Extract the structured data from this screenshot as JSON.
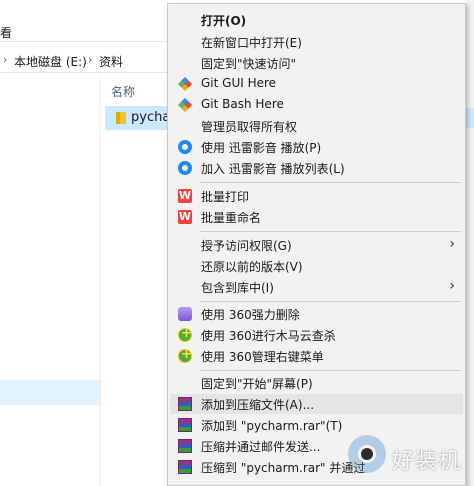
{
  "explorer": {
    "ribbon_view": "看",
    "breadcrumb": [
      "本地磁盘 (E:)",
      "资料"
    ],
    "column_name": "名称",
    "file_name": "pycharm"
  },
  "menu": {
    "open": "打开(O)",
    "open_new_window": "在新窗口中打开(E)",
    "pin_quick_access": "固定到\"快速访问\"",
    "git_gui": "Git GUI Here",
    "git_bash": "Git Bash Here",
    "take_ownership": "管理员取得所有权",
    "xunlei_play": "使用 迅雷影音 播放(P)",
    "xunlei_add": "加入 迅雷影音 播放列表(L)",
    "batch_print": "批量打印",
    "batch_rename": "批量重命名",
    "grant_access": "授予访问权限(G)",
    "restore_versions": "还原以前的版本(V)",
    "include_library": "包含到库中(I)",
    "s360_delete": "使用 360强力删除",
    "s360_scan": "使用 360进行木马云查杀",
    "s360_menu": "使用 360管理右键菜单",
    "pin_start": "固定到\"开始\"屏幕(P)",
    "add_archive": "添加到压缩文件(A)...",
    "add_to_rar": "添加到 \"pycharm.rar\"(T)",
    "compress_email": "压缩并通过邮件发送...",
    "compress_rar_email": "压缩到 \"pycharm.rar\" 并通过"
  },
  "watermark": {
    "text": "好装机"
  },
  "icons": [
    "folder-icon",
    "git-icon",
    "xunlei-icon",
    "wps-icon",
    "360-delete-icon",
    "360-icon",
    "winrar-icon",
    "chevron-right-icon"
  ],
  "colors": {
    "menu_bg": "#f2f2f2",
    "hover": "#e5e5e5",
    "selection": "#cce8ff",
    "wps": "#e8443a"
  }
}
